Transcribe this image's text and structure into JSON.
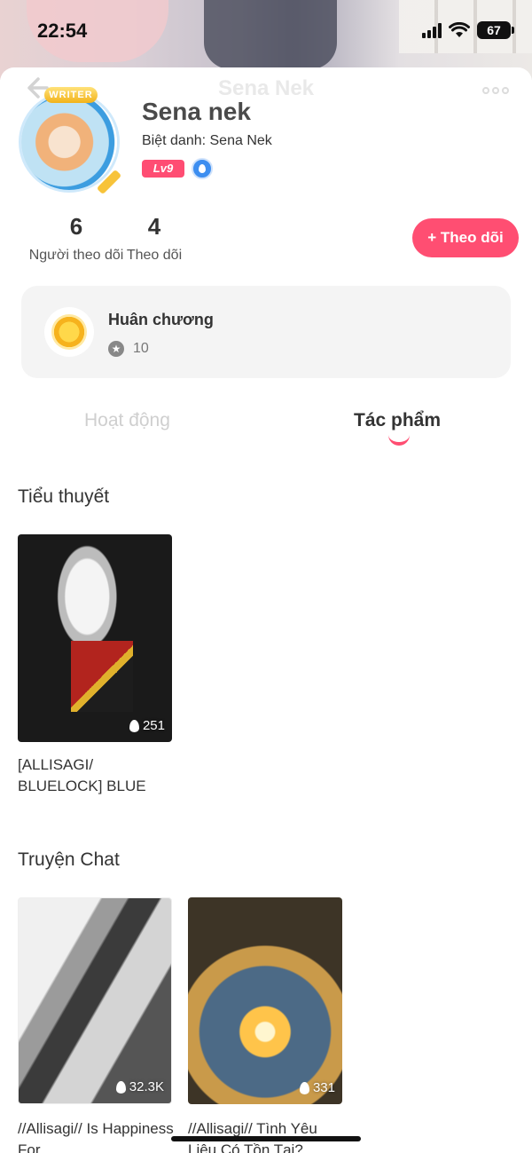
{
  "status": {
    "time": "22:54",
    "battery": "67"
  },
  "nav": {
    "title": "Sena Nek"
  },
  "profile": {
    "badge": "WRITER",
    "name": "Sena nek",
    "nickname": "Biệt danh: Sena Nek",
    "level": "Lv9"
  },
  "stats": {
    "followers_count": "6",
    "followers_label": "Người theo dõi",
    "following_count": "4",
    "following_label": "Theo dõi"
  },
  "follow_button": "+ Theo dõi",
  "medals": {
    "title": "Huân chương",
    "count": "10"
  },
  "tabs": [
    {
      "label": "Hoạt động",
      "active": false
    },
    {
      "label": "Tác phẩm",
      "active": true
    }
  ],
  "sections": {
    "novels": {
      "title": "Tiểu thuyết",
      "items": [
        {
          "title": "[ALLISAGI/ BLUELOCK] BLUE",
          "views": "251"
        }
      ]
    },
    "chats": {
      "title": "Truyện Chat",
      "items": [
        {
          "title": "//Allisagi// Is Happiness For",
          "views": "32.3K"
        },
        {
          "title": "//Allisagi// Tình Yêu Liệu Có Tồn Tại?",
          "views": "331"
        }
      ]
    }
  },
  "colors": {
    "accent": "#ff4e72",
    "level_badge": "#ff4d73",
    "card_bg": "#f4f4f4"
  }
}
